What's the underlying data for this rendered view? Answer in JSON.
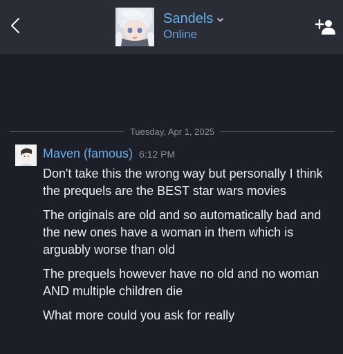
{
  "header": {
    "contact_name": "Sandels",
    "status": "Online",
    "back_icon": "chevron-left-icon",
    "dropdown_icon": "chevron-down-icon",
    "add_friend_icon": "add-friend-icon"
  },
  "chat": {
    "date_separator": "Tuesday, Apr 1, 2025",
    "messages": [
      {
        "sender": "Maven (famous)",
        "time": "6:12 PM",
        "lines": [
          "Don't take this the wrong way but personally I think the prequels are the BEST star wars movies",
          "The originals are old and so automatically bad and the new ones have a woman in them which is arguably worse than old",
          "The prequels however have no old and no woman AND multiple children die",
          "What more could you ask for really"
        ]
      }
    ]
  },
  "colors": {
    "background": "#1d1f28",
    "header_bg": "#2a2c36",
    "accent_blue": "#6aaee8",
    "status_blue": "#6f9fcc",
    "muted_text": "#8b8e98",
    "body_text": "#eceef2"
  }
}
